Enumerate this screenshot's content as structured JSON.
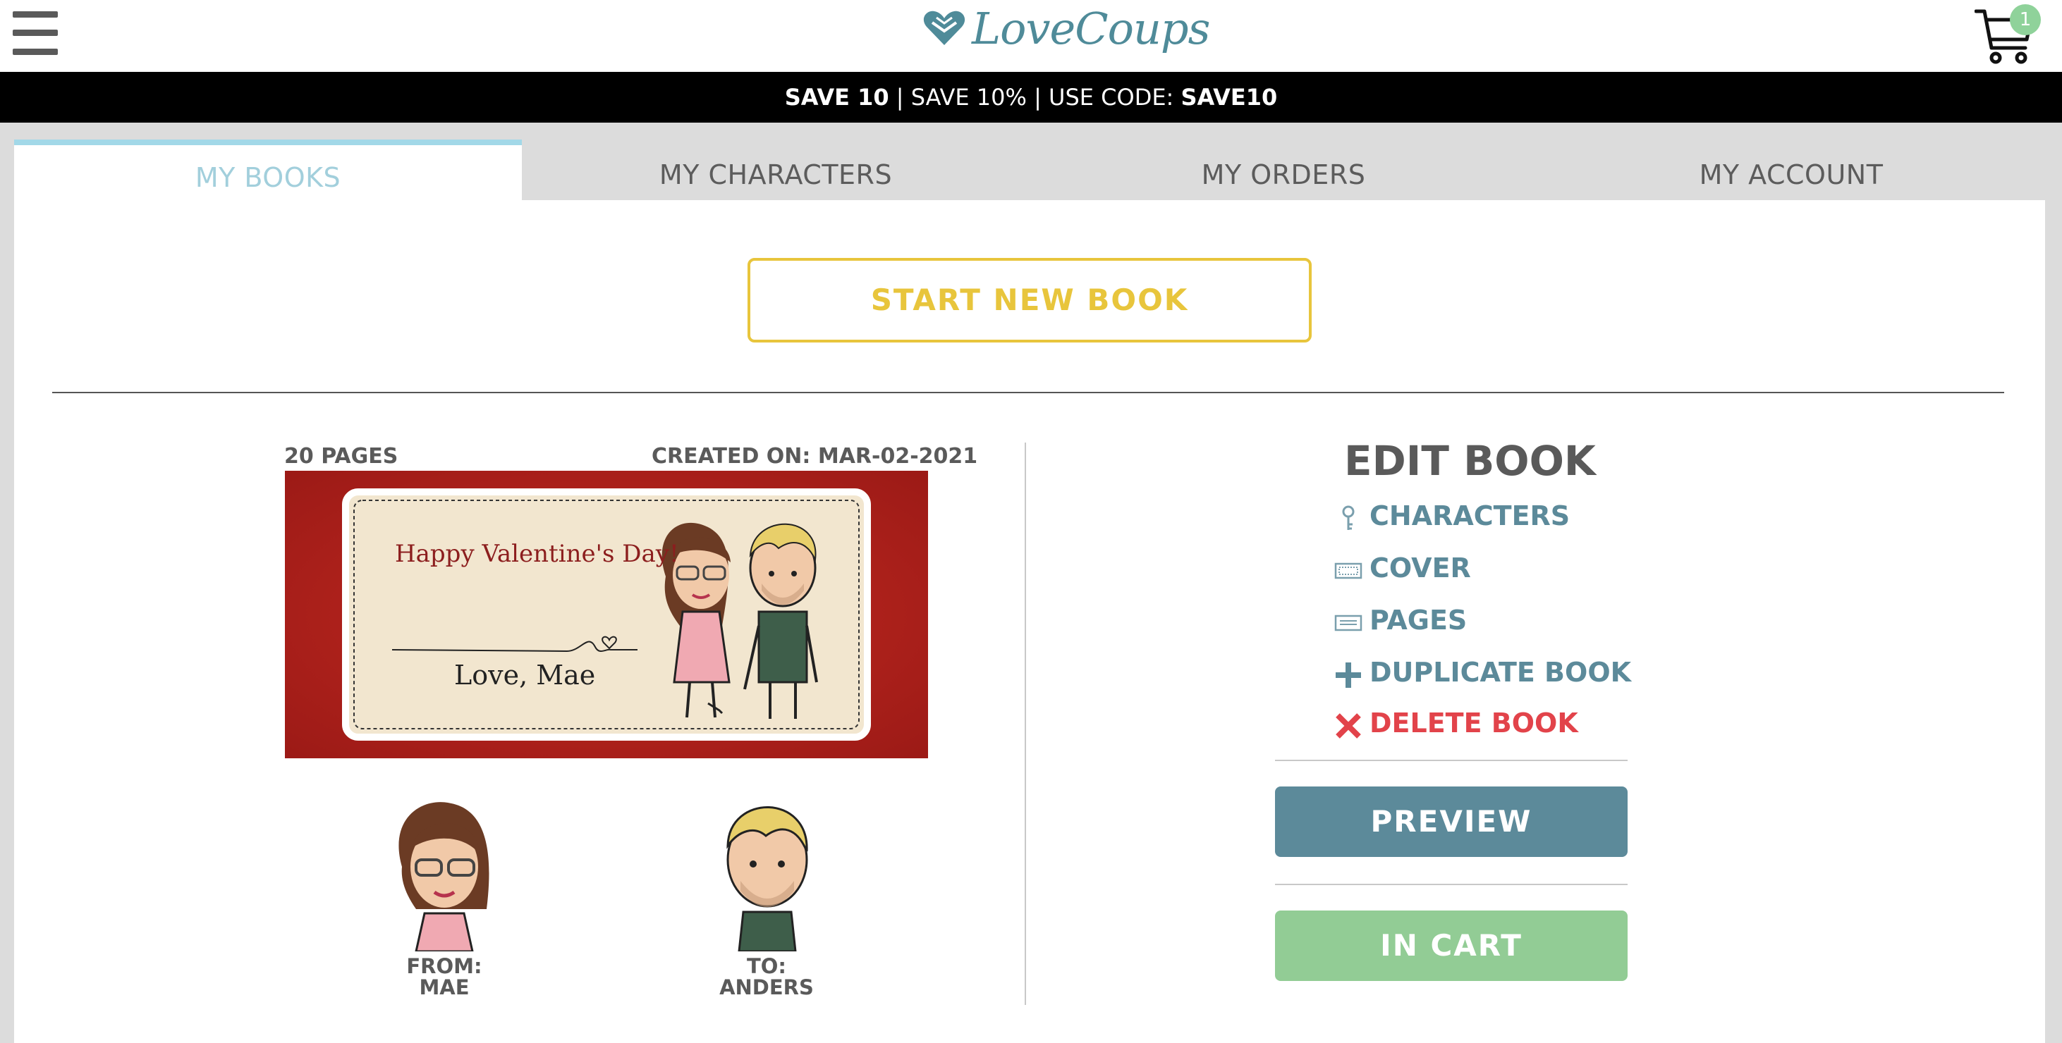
{
  "header": {
    "brand": "LoveCoups",
    "cart_count": "1"
  },
  "promo": {
    "part1": "SAVE 10",
    "part2": " | SAVE 10% | USE CODE: ",
    "code": "SAVE10"
  },
  "tabs": [
    {
      "label": "MY BOOKS",
      "active": true
    },
    {
      "label": "MY CHARACTERS",
      "active": false
    },
    {
      "label": "MY ORDERS",
      "active": false
    },
    {
      "label": "MY ACCOUNT",
      "active": false
    }
  ],
  "start_new_book": "START NEW BOOK",
  "book": {
    "pages": "20 PAGES",
    "created": "CREATED ON: MAR-02-2021",
    "cover_greeting": "Happy Valentine's Day!",
    "cover_sign": "Love, Mae",
    "from_label": "FROM:",
    "from_name": "MAE",
    "to_label": "TO:",
    "to_name": "ANDERS"
  },
  "edit": {
    "title": "EDIT BOOK",
    "items": [
      {
        "label": "CHARACTERS",
        "icon": "key-icon"
      },
      {
        "label": "COVER",
        "icon": "cover-icon"
      },
      {
        "label": "PAGES",
        "icon": "pages-icon"
      },
      {
        "label": "DUPLICATE BOOK",
        "icon": "plus-icon"
      },
      {
        "label": "DELETE BOOK",
        "icon": "x-icon"
      }
    ],
    "preview": "PREVIEW",
    "in_cart": "IN CART"
  },
  "colors": {
    "accent_teal": "#5c8a9a",
    "accent_yellow": "#e8c53c",
    "accent_green": "#92cc95",
    "danger_red": "#e2434a",
    "active_tab": "#a2cfdc"
  }
}
